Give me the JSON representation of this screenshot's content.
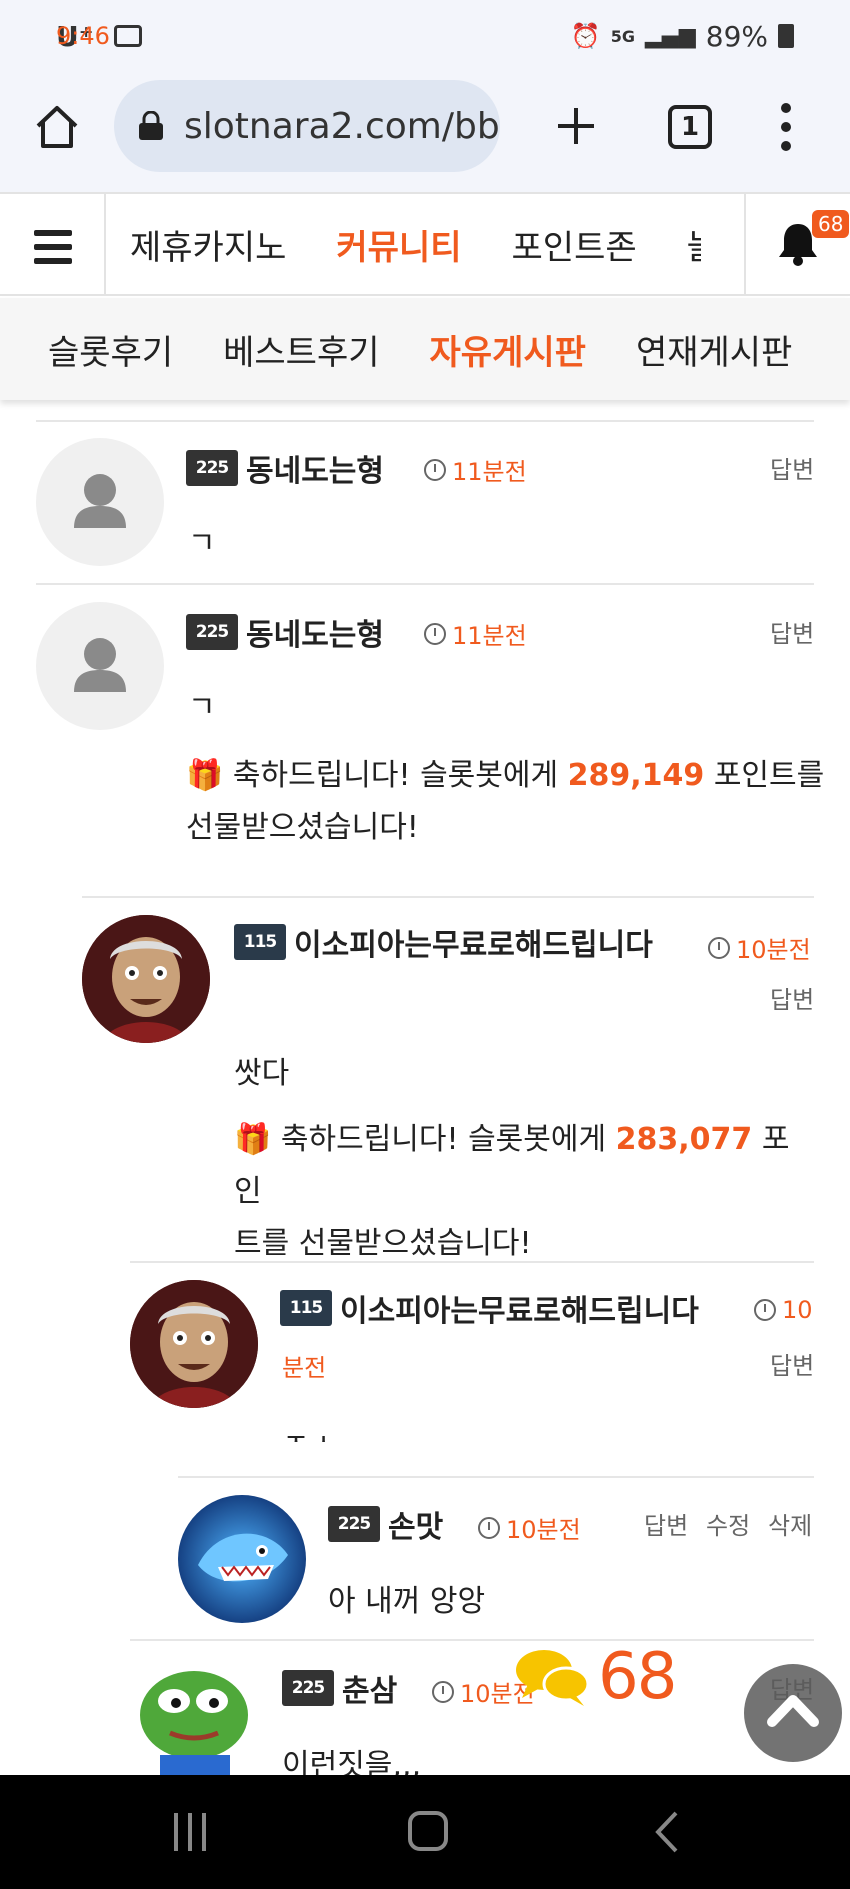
{
  "status_bar": {
    "carrier": "U⁺",
    "time": "9:46",
    "battery": "89%"
  },
  "browser": {
    "url": "slotnara2.com/bb",
    "tab_count": "1"
  },
  "site_nav": {
    "items": [
      {
        "label": "제휴카지노"
      },
      {
        "label": "커뮤니티"
      },
      {
        "label": "포인트존"
      },
      {
        "label": "늘"
      }
    ],
    "notification_count": "68"
  },
  "sub_nav": {
    "items": [
      {
        "label": "슬롯후기"
      },
      {
        "label": "베스트후기"
      },
      {
        "label": "자유게시판"
      },
      {
        "label": "연재게시판"
      }
    ]
  },
  "comments": [
    {
      "level": "225",
      "username": "동네도는형",
      "time": "11분전",
      "reply_label": "답변",
      "body": "ㄱ"
    },
    {
      "level": "225",
      "username": "동네도는형",
      "time": "11분전",
      "reply_label": "답변",
      "body": "ㄱ",
      "gift_prefix": "축하드립니다! 슬롯봇에게",
      "gift_points": "289,149",
      "gift_suffix_1": "포인트를",
      "gift_suffix_2": "선물받으셨습니다!"
    },
    {
      "level": "115",
      "username": "이소피아는무료로해드립니다",
      "time": "10분전",
      "reply_label": "답변",
      "body": "쌋다",
      "gift_prefix": "축하드립니다! 슬롯봇에게",
      "gift_points": "283,077",
      "gift_suffix_1": "포인",
      "gift_suffix_2": "트를 선물받으셨습니다!"
    },
    {
      "level": "115",
      "username": "이소피아는무료로해드립니다",
      "time_1": "10",
      "time_2": "분전",
      "reply_label": "답변",
      "body": "ㅈㅅ"
    },
    {
      "level": "225",
      "username": "손맛",
      "time": "10분전",
      "reply_label": "답변",
      "edit_label": "수정",
      "delete_label": "삭제",
      "body": "아 내꺼 앙앙"
    },
    {
      "level": "225",
      "username": "춘삼",
      "time": "10분전",
      "reply_label": "답변",
      "body": "이런짓을,,,"
    }
  ],
  "floating": {
    "comment_count": "68"
  }
}
